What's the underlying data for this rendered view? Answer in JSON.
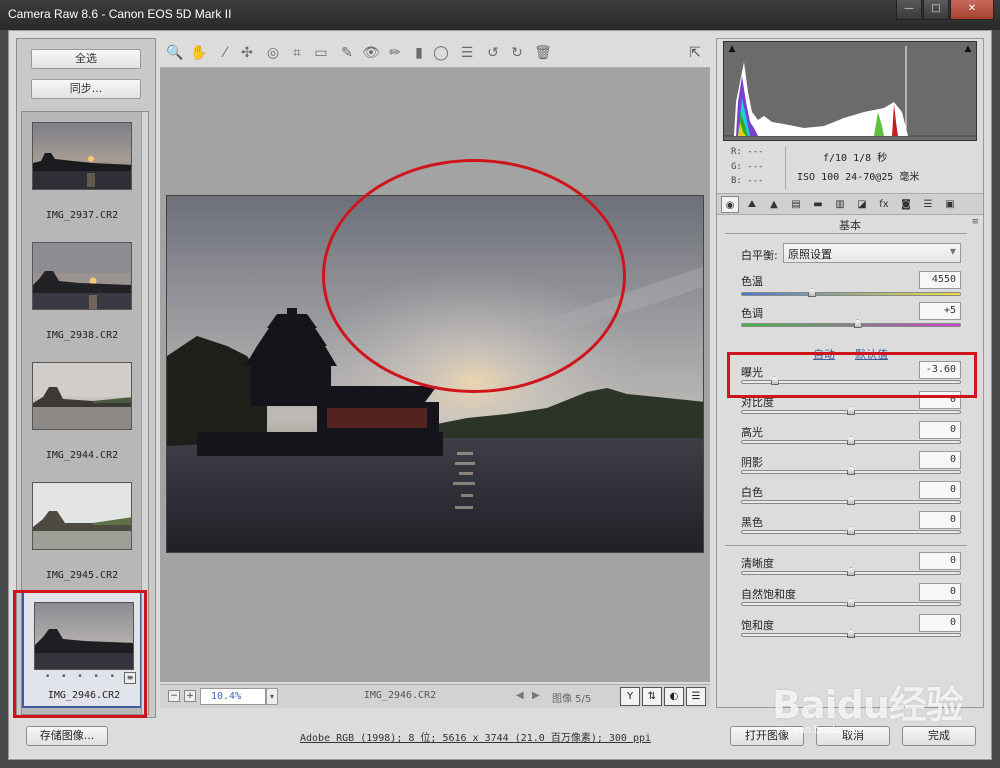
{
  "window": {
    "title": "Camera Raw 8.6  -  Canon EOS 5D Mark II",
    "minimize": "—",
    "maximize": "□",
    "close": "✕"
  },
  "filmstrip": {
    "select_all": "全选",
    "sync": "同步...",
    "items": [
      {
        "name": "IMG_2937.CR2"
      },
      {
        "name": "IMG_2938.CR2"
      },
      {
        "name": "IMG_2944.CR2"
      },
      {
        "name": "IMG_2945.CR2"
      },
      {
        "name": "IMG_2946.CR2",
        "selected": true,
        "stars": "• • • • •"
      }
    ]
  },
  "toolbar": {
    "tools": [
      "zoom-tool",
      "hand-tool",
      "white-balance-tool",
      "color-sampler-tool",
      "targeted-adjustment-tool",
      "crop-tool",
      "straighten-tool",
      "spot-removal-tool",
      "red-eye-tool",
      "adjustment-brush",
      "graduated-filter",
      "radial-filter",
      "preferences",
      "rotate-left",
      "rotate-right",
      "trash"
    ],
    "glyphs": [
      "🔍",
      "✋",
      "⁄",
      "✣",
      "◎",
      "⌗",
      "▭",
      "✎",
      "👁",
      "✏",
      "▮",
      "◯",
      "☰",
      "↺",
      "↻",
      "🗑"
    ],
    "open_glyph": "⇱"
  },
  "preview": {
    "zoom_minus": "−",
    "zoom_plus": "+",
    "zoom": "10.4%",
    "zoom_arrow": "▾",
    "filename": "IMG_2946.CR2",
    "prev": "◀",
    "next": "▶",
    "image_count": "图像 5/5",
    "view_buttons": [
      "Y",
      "⇅",
      "◐",
      "☰"
    ]
  },
  "histogram": {
    "clip_shadow": "▲",
    "clip_highlight": "▲",
    "r": "R:  ---",
    "g": "G:  ---",
    "b": "B:  ---",
    "aperture_shutter": "f/10   1/8 秒",
    "iso_lens": "ISO 100   24-70@25 毫米"
  },
  "panel": {
    "tabs": [
      "◉",
      "⛰",
      "▲",
      "▤",
      "▬",
      "▥",
      "◪",
      "fx",
      "◙",
      "☰",
      "▣"
    ],
    "title": "基本",
    "menu": "≡",
    "white_balance_label": "白平衡:",
    "white_balance_value": "原照设置",
    "temperature_label": "色温",
    "temperature_value": "4550",
    "tint_label": "色调",
    "tint_value": "+5",
    "auto_link": "自动",
    "default_link": "默认值",
    "sliders": [
      {
        "label": "曝光",
        "value": "-3.60",
        "pos": 0.15
      },
      {
        "label": "对比度",
        "value": "0",
        "pos": 0.5
      },
      {
        "label": "高光",
        "value": "0",
        "pos": 0.5
      },
      {
        "label": "阴影",
        "value": "0",
        "pos": 0.5
      },
      {
        "label": "白色",
        "value": "0",
        "pos": 0.5
      },
      {
        "label": "黑色",
        "value": "0",
        "pos": 0.5
      }
    ],
    "presence": [
      {
        "label": "清晰度",
        "value": "0",
        "pos": 0.5
      },
      {
        "label": "自然饱和度",
        "value": "0",
        "pos": 0.5
      },
      {
        "label": "饱和度",
        "value": "0",
        "pos": 0.5
      }
    ],
    "temperature_pos": 0.32,
    "tint_pos": 0.53
  },
  "bottom": {
    "save": "存储图像...",
    "workflow": "Adobe RGB (1998); 8 位; 5616 x 3744 (21.0 百万像素); 300 ppi",
    "open": "打开图像",
    "cancel": "取消",
    "done": "完成"
  },
  "watermark": {
    "logo": "Baidu经验",
    "url": "jingyan.baidu.com"
  },
  "colors": {
    "annotation": "#d0141c",
    "selection": "#3d5b9a",
    "link": "#3f5f9c"
  }
}
